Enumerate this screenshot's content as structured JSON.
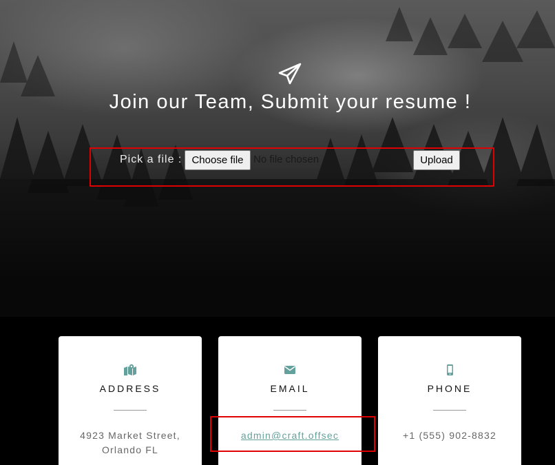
{
  "hero": {
    "title": "Join our Team, Submit your resume !",
    "icon": "paper-plane-icon"
  },
  "upload_form": {
    "label": "Pick a file :",
    "choose_button": "Choose file",
    "file_status": "No file chosen",
    "upload_button": "Upload"
  },
  "contacts": [
    {
      "icon": "map-icon",
      "title": "ADDRESS",
      "line1": "4923 Market Street,",
      "line2": "Orlando FL"
    },
    {
      "icon": "envelope-icon",
      "title": "EMAIL",
      "value": "admin@craft.offsec"
    },
    {
      "icon": "mobile-phone-icon",
      "title": "PHONE",
      "value": "+1 (555) 902-8832"
    }
  ],
  "colors": {
    "accent": "#64a19d",
    "highlight": "#e10000",
    "card_bg": "#ffffff",
    "page_bg": "#000000"
  }
}
